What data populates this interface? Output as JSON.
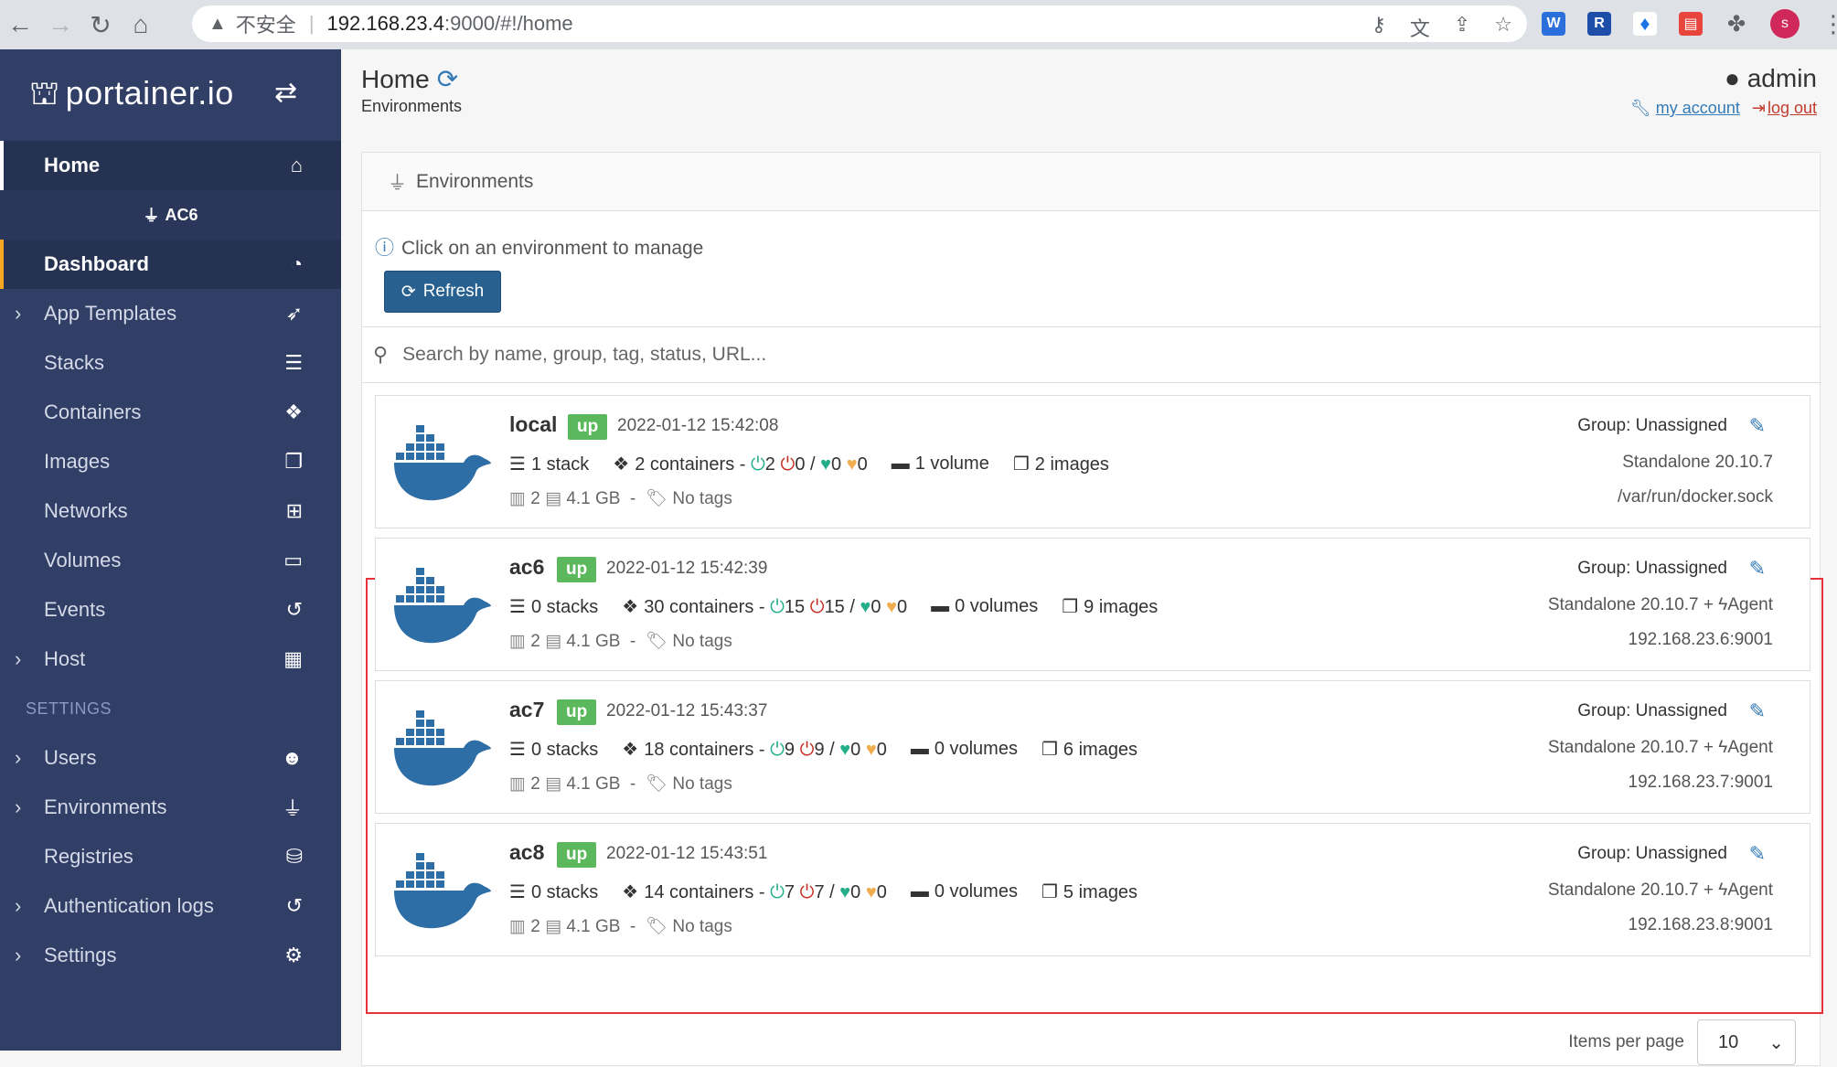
{
  "browser": {
    "insecure_label": "不安全",
    "url_host": "192.168.23.4",
    "url_path": ":9000/#!/home",
    "profile_initial": "s"
  },
  "sidebar": {
    "brand": "portainer.io",
    "home": "Home",
    "env_name": "AC6",
    "items": [
      {
        "label": "Dashboard"
      },
      {
        "label": "App Templates"
      },
      {
        "label": "Stacks"
      },
      {
        "label": "Containers"
      },
      {
        "label": "Images"
      },
      {
        "label": "Networks"
      },
      {
        "label": "Volumes"
      },
      {
        "label": "Events"
      },
      {
        "label": "Host"
      }
    ],
    "settings_title": "SETTINGS",
    "settings_items": [
      {
        "label": "Users"
      },
      {
        "label": "Environments"
      },
      {
        "label": "Registries"
      },
      {
        "label": "Authentication logs"
      },
      {
        "label": "Settings"
      }
    ]
  },
  "header": {
    "title": "Home",
    "subtitle": "Environments",
    "user": "admin",
    "my_account": "my account",
    "log_out": "log out"
  },
  "panel": {
    "title": "Environments",
    "hint": "Click on an environment to manage",
    "refresh": "Refresh",
    "search_placeholder": "Search by name, group, tag, status, URL..."
  },
  "environments": [
    {
      "name": "local",
      "status": "up",
      "time": "2022-01-12 15:42:08",
      "stacks": "1 stack",
      "containers": "2 containers -",
      "running": "2",
      "stopped": "0",
      "slash": "/",
      "healthy": "0",
      "unhealthy": "0",
      "volumes": "1 volume",
      "images": "2 images",
      "cpu": "2",
      "mem": "4.1 GB",
      "dash": "-",
      "tags": "No tags",
      "group": "Group: Unassigned",
      "type": "Standalone 20.10.7",
      "url": "/var/run/docker.sock"
    },
    {
      "name": "ac6",
      "status": "up",
      "time": "2022-01-12 15:42:39",
      "stacks": "0 stacks",
      "containers": "30 containers -",
      "running": "15",
      "stopped": "15",
      "slash": "/",
      "healthy": "0",
      "unhealthy": "0",
      "volumes": "0 volumes",
      "images": "9 images",
      "cpu": "2",
      "mem": "4.1 GB",
      "dash": "-",
      "tags": "No tags",
      "group": "Group: Unassigned",
      "type": "Standalone 20.10.7 + ",
      "agent": "Agent",
      "url": "192.168.23.6:9001"
    },
    {
      "name": "ac7",
      "status": "up",
      "time": "2022-01-12 15:43:37",
      "stacks": "0 stacks",
      "containers": "18 containers -",
      "running": "9",
      "stopped": "9",
      "slash": "/",
      "healthy": "0",
      "unhealthy": "0",
      "volumes": "0 volumes",
      "images": "6 images",
      "cpu": "2",
      "mem": "4.1 GB",
      "dash": "-",
      "tags": "No tags",
      "group": "Group: Unassigned",
      "type": "Standalone 20.10.7 + ",
      "agent": "Agent",
      "url": "192.168.23.7:9001"
    },
    {
      "name": "ac8",
      "status": "up",
      "time": "2022-01-12 15:43:51",
      "stacks": "0 stacks",
      "containers": "14 containers -",
      "running": "7",
      "stopped": "7",
      "slash": "/",
      "healthy": "0",
      "unhealthy": "0",
      "volumes": "0 volumes",
      "images": "5 images",
      "cpu": "2",
      "mem": "4.1 GB",
      "dash": "-",
      "tags": "No tags",
      "group": "Group: Unassigned",
      "type": "Standalone 20.10.7 + ",
      "agent": "Agent",
      "url": "192.168.23.8:9001"
    }
  ],
  "footer": {
    "items_per_page_label": "Items per page",
    "items_per_page_value": "10"
  },
  "colors": {
    "sidebar_bg": "#313e66",
    "accent_blue": "#286090",
    "status_up": "#5cb85c",
    "highlight_red": "#e8333a"
  }
}
